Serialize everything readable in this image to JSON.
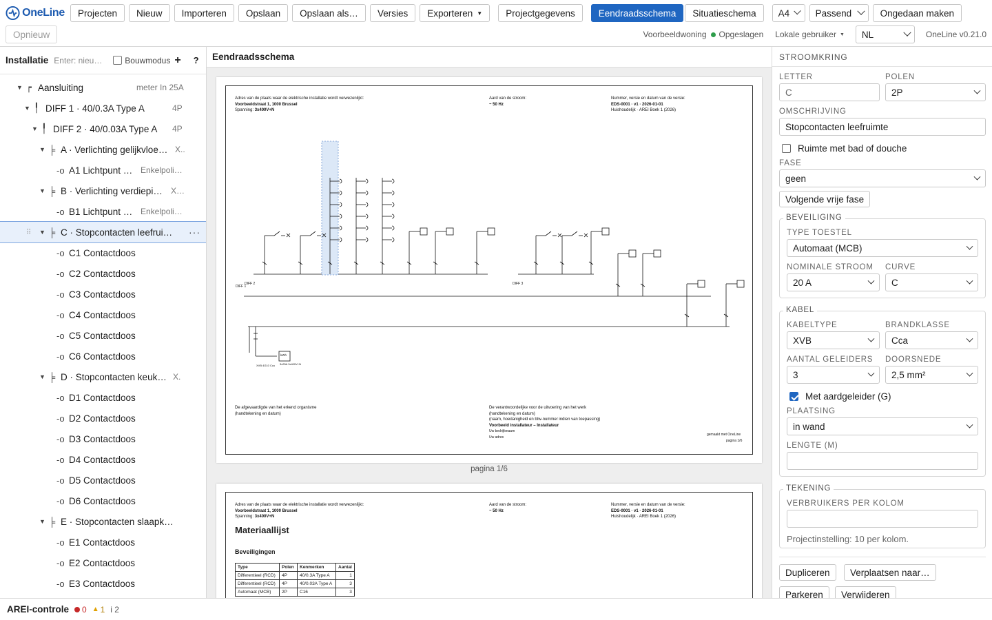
{
  "app": {
    "logo": "OneLine",
    "version": "OneLine v0.21.0"
  },
  "toolbar": {
    "projects": "Projecten",
    "new": "Nieuw",
    "import": "Importeren",
    "save": "Opslaan",
    "save_as": "Opslaan als…",
    "versions": "Versies",
    "export": "Exporteren",
    "project_data": "Projectgegevens",
    "single_line": "Eendraadsschema",
    "site_plan": "Situatieschema",
    "paper": "A4",
    "fit": "Passend",
    "undo": "Ongedaan maken",
    "redo": "Opnieuw"
  },
  "status": {
    "project": "Voorbeeldwoning",
    "saved": "Opgeslagen",
    "user": "Lokale gebruiker",
    "lang": "NL"
  },
  "left": {
    "title": "Installatie",
    "input_placeholder": "Enter: nieu…",
    "build_mode": "Bouwmodus",
    "add": "+",
    "help": "?",
    "tree": [
      {
        "label": "Aansluiting",
        "meta": "meter In 25A"
      },
      {
        "label": "DIFF 1 · 40/0.3A Type A",
        "meta": "4P"
      },
      {
        "label": "DIFF 2 · 40/0.03A Type A",
        "meta": "4P"
      },
      {
        "label": "A · Verlichting gelijkvloe…",
        "meta": "X.."
      },
      {
        "label": "A1 Lichtpunt …",
        "meta": "Enkelpoli…"
      },
      {
        "label": "B · Verlichting verdiepi…",
        "meta": "X…"
      },
      {
        "label": "B1 Lichtpunt …",
        "meta": "Enkelpoli…"
      },
      {
        "label": "C · Stopcontacten leefrui…",
        "meta": "···"
      },
      {
        "label": "C1 Contactdoos"
      },
      {
        "label": "C2 Contactdoos"
      },
      {
        "label": "C3 Contactdoos"
      },
      {
        "label": "C4 Contactdoos"
      },
      {
        "label": "C5 Contactdoos"
      },
      {
        "label": "C6 Contactdoos"
      },
      {
        "label": "D · Stopcontacten keuk…",
        "meta": "X."
      },
      {
        "label": "D1 Contactdoos"
      },
      {
        "label": "D2 Contactdoos"
      },
      {
        "label": "D3 Contactdoos"
      },
      {
        "label": "D4 Contactdoos"
      },
      {
        "label": "D5 Contactdoos"
      },
      {
        "label": "D6 Contactdoos"
      },
      {
        "label": "E · Stopcontacten slaapk…"
      },
      {
        "label": "E1 Contactdoos"
      },
      {
        "label": "E2 Contactdoos"
      },
      {
        "label": "E3 Contactdoos"
      }
    ]
  },
  "center": {
    "title": "Eendraadsschema",
    "sheet": {
      "addr_label": "Adres van de plaats waar de elektrische installatie wordt verwezenlijkt:",
      "addr": "Voorbeeldstraat 1, 1000 Brussel",
      "voltage_label": "Spanning:",
      "voltage": "3x400V+N",
      "current_label": "Aard van de stroom:",
      "current": "~ 50 Hz",
      "doc_label": "Nummer, versie en datum van de versie:",
      "doc": "EDS-0001 · v1 · 2026-01-01",
      "doc_sub": "Huishoudelijk · AREI Boek 1 (2026)",
      "org_label": "De afgevaardigde van het erkend organisme",
      "org_sub": "(handtekening en datum)",
      "resp_label": "De verantwoordelijke voor de uitvoering van het werk",
      "resp_sub1": "(handtekening en datum)",
      "resp_sub2": "(naam, hoedanigheid en btw-nummer indien van toepassing)",
      "installer": "Voorbeeld installateur – Installateur",
      "company": "Uw bedrijfsnaam",
      "company_addr": "Uw adres",
      "made_with": "gemaakt met OneLine",
      "page": "pagina 1/6",
      "diff1": "DIFF 1",
      "diff2": "DIFF 2",
      "diff3": "DIFF 3",
      "kwh": "kWh",
      "meter": "3x25A 3x400V+N",
      "cable_in": "XVB 4G10 Ccu"
    },
    "page_label": "pagina 1/6",
    "sheet2": {
      "title": "Materiaallijst",
      "section": "Beveiligingen",
      "cols": [
        "Type",
        "Polen",
        "Kenmerken",
        "Aantal"
      ],
      "rows": [
        [
          "Differentieel (RCD)",
          "4P",
          "40/0.3A Type A",
          "1"
        ],
        [
          "Differentieel (RCD)",
          "4P",
          "40/0.03A Type A",
          "3"
        ],
        [
          "Automaat (MCB)",
          "2P",
          "C16",
          "3"
        ]
      ]
    }
  },
  "right": {
    "section": "STROOMKRING",
    "letter_label": "LETTER",
    "letter": "C",
    "poles_label": "POLEN",
    "poles": "2P",
    "desc_label": "OMSCHRIJVING",
    "desc": "Stopcontacten leefruimte",
    "bath": "Ruimte met bad of douche",
    "phase_label": "FASE",
    "phase": "geen",
    "next_phase": "Volgende vrije fase",
    "protection": "BEVEILIGING",
    "device_label": "TYPE TOESTEL",
    "device": "Automaat (MCB)",
    "nominal_label": "NOMINALE STROOM",
    "nominal": "20 A",
    "curve_label": "CURVE",
    "curve": "C",
    "cable": "KABEL",
    "cable_type_label": "KABELTYPE",
    "cable_type": "XVB",
    "fire_label": "BRANDKLASSE",
    "fire": "Cca",
    "cond_label": "AANTAL GELEIDERS",
    "cond": "3",
    "section_label": "DOORSNEDE",
    "section_val": "2,5 mm²",
    "earth": "Met aardgeleider (G)",
    "placement_label": "PLAATSING",
    "placement": "in wand",
    "length_label": "LENGTE (M)",
    "drawing": "TEKENING",
    "per_col_label": "VERBRUIKERS PER KOLOM",
    "per_col_hint": "Projectinstelling: 10 per kolom.",
    "duplicate": "Dupliceren",
    "move": "Verplaatsen naar…",
    "park": "Parkeren",
    "delete": "Verwijderen"
  },
  "bottom": {
    "title": "AREI-controle",
    "errors": "0",
    "warnings": "1",
    "info": "i 2"
  },
  "colors": {
    "accent": "#1f66c1",
    "ok": "#2e9d4b",
    "error": "#c62828",
    "warn": "#e0a000"
  }
}
